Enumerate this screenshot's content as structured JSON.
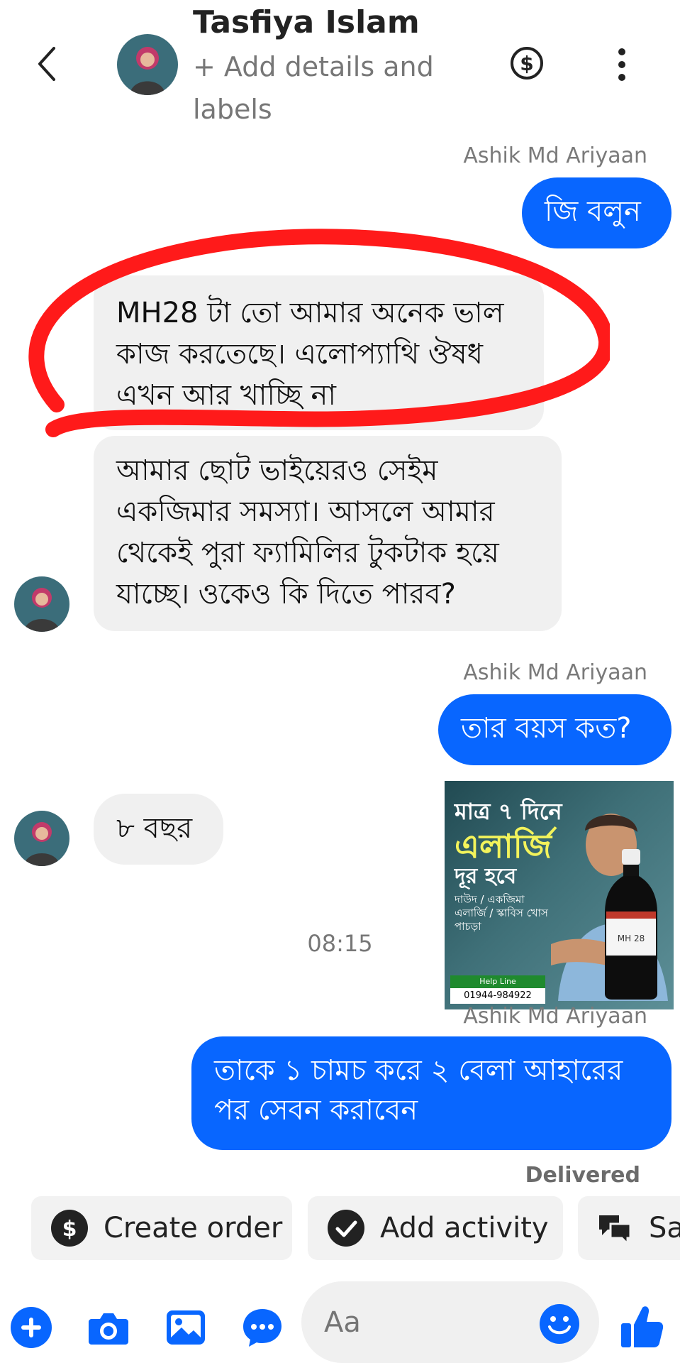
{
  "header": {
    "contact_name": "Tasfiya Islam",
    "subtitle": "+ Add details and labels",
    "icons": [
      "back-icon",
      "dollar-icon",
      "more-vertical-icon"
    ]
  },
  "messages": {
    "sender_1": "Ashik Md Ariyaan",
    "out_1": "জি বলুন",
    "in_1": "MH28 টা তো আমার অনেক ভাল কাজ করতেছে। এলোপ্যাথি ঔষধ এখন আর খাচ্ছি না",
    "in_2": "আমার ছোট ভাইয়েরও সেইম একজিমার সমস্যা। আসলে আমার থেকেই পুরা ফ্যামিলির টুকটাক হয়ে যাচ্ছে। ওকেও কি দিতে পারব?",
    "sender_2": "Ashik Md Ariyaan",
    "out_2": "তার বয়স কত?",
    "in_3": "৮ বছর",
    "time": "08:15",
    "sender_3": "Ashik Md Ariyaan",
    "out_3": "তাকে ১ চামচ করে ২ বেলা আহারের পর সেবন করাবেন",
    "status": "Delivered"
  },
  "ad": {
    "line1": "মাত্র ৭ দিনে",
    "line2": "এলার্জি",
    "line3": "দূর হবে",
    "line4": "দাউদ / একজিমা এলার্জি / স্কাবিস খোস পাচড়া",
    "helpline": "Help Line",
    "phone": "01944-984922",
    "bottle_label": "MH 28"
  },
  "quick_actions": {
    "create_order": "Create order",
    "add_activity": "Add activity",
    "saved": "Sa"
  },
  "composer": {
    "placeholder": "Aa"
  },
  "colors": {
    "accent": "#0866ff",
    "annotation": "#ff1a1a",
    "incoming_bubble": "#f0f0f0"
  }
}
